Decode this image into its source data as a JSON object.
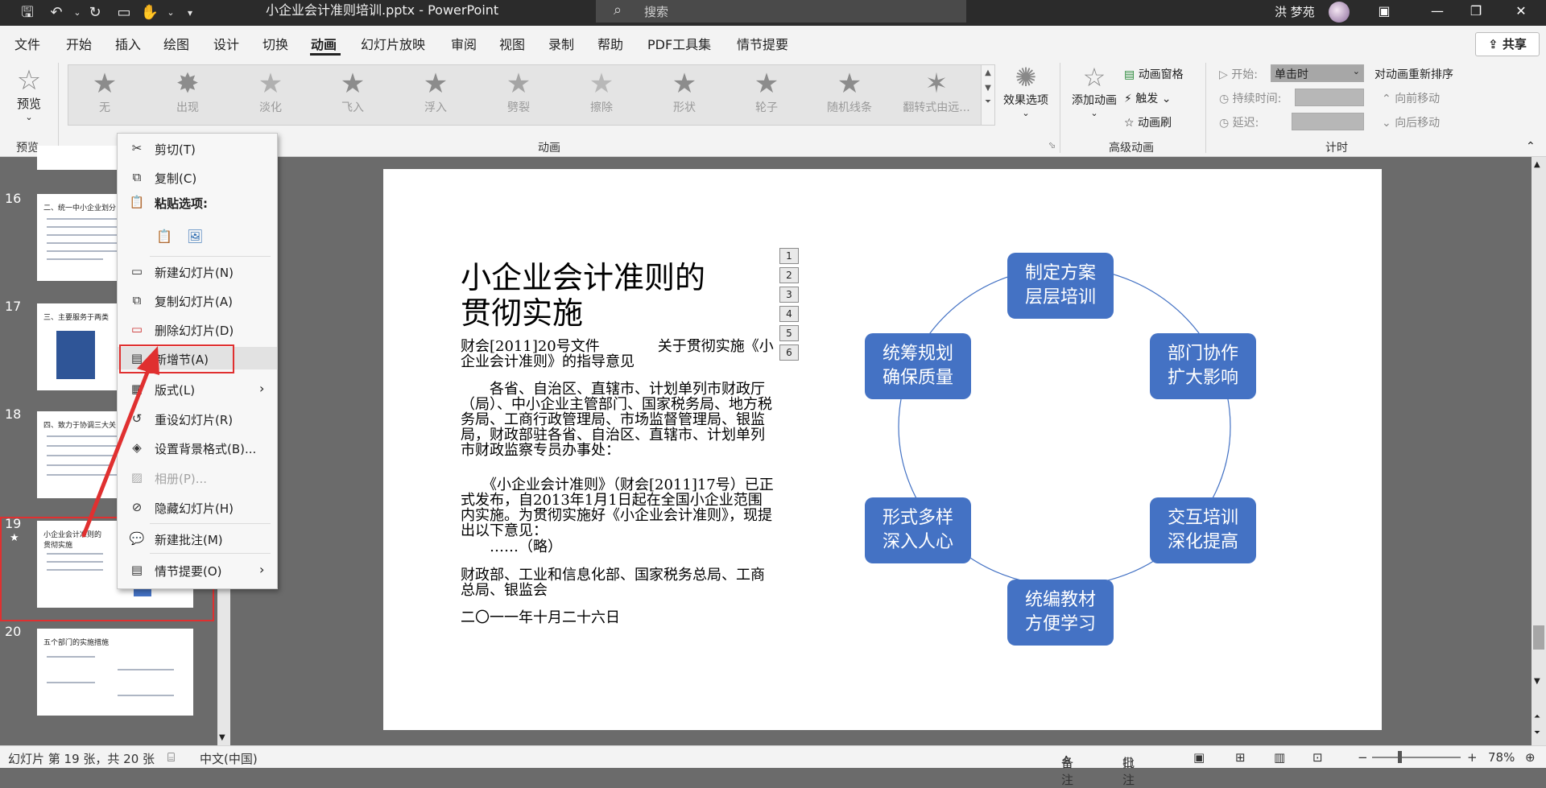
{
  "titlebar": {
    "doc_title": "小企业会计准则培训.pptx  -  PowerPoint",
    "search_placeholder": "搜索",
    "user_name": "洪 梦苑"
  },
  "menu": {
    "tabs": [
      "文件",
      "开始",
      "插入",
      "绘图",
      "设计",
      "切换",
      "动画",
      "幻灯片放映",
      "审阅",
      "视图",
      "录制",
      "帮助",
      "PDF工具集",
      "情节提要"
    ],
    "active_tab": "动画",
    "share_label": "共享"
  },
  "ribbon": {
    "preview_label": "预览",
    "preview_group": "预览",
    "animations": [
      "无",
      "出现",
      "淡化",
      "飞入",
      "浮入",
      "劈裂",
      "擦除",
      "形状",
      "轮子",
      "随机线条",
      "翻转式由远..."
    ],
    "effect_options": "效果选项",
    "animation_group": "动画",
    "add_animation": "添加动画",
    "animation_pane": "动画窗格",
    "trigger": "触发",
    "animation_painter": "动画刷",
    "advanced_group": "高级动画",
    "start_label": "开始:",
    "start_value": "单击时",
    "duration_label": "持续时间:",
    "delay_label": "延迟:",
    "timing_group": "计时",
    "reorder_label": "对动画重新排序",
    "move_earlier": "向前移动",
    "move_later": "向后移动"
  },
  "thumbnails": [
    {
      "num": "16",
      "title": "二、统一中小企业划分"
    },
    {
      "num": "17",
      "title": "三、主要服务于两类"
    },
    {
      "num": "18",
      "title": "四、致力于协调三大关"
    },
    {
      "num": "19",
      "title": "小企业会计准则的贯彻实施"
    },
    {
      "num": "20",
      "title": "五个部门的实施措施"
    }
  ],
  "context_menu": {
    "cut": "剪切(T)",
    "copy": "复制(C)",
    "paste_options": "粘贴选项:",
    "new_slide": "新建幻灯片(N)",
    "duplicate_slide": "复制幻灯片(A)",
    "delete_slide": "删除幻灯片(D)",
    "add_section": "新增节(A)",
    "layout": "版式(L)",
    "reset_slide": "重设幻灯片(R)",
    "format_background": "设置背景格式(B)...",
    "photo_album": "相册(P)...",
    "hide_slide": "隐藏幻灯片(H)",
    "new_comment": "新建批注(M)",
    "storyboard": "情节提要(O)"
  },
  "slide": {
    "title": "小企业会计准则的贯彻实施",
    "para1": "财会[2011]20号文件　　　　关于贯彻实施《小企业会计准则》的指导意见",
    "para2": "　　各省、自治区、直辖市、计划单列市财政厅（局）、中小企业主管部门、国家税务局、地方税务局、工商行政管理局、市场监督管理局、银监局，财政部驻各省、自治区、直辖市、计划单列市财政监察专员办事处：",
    "para3": "　　《小企业会计准则》（财会[2011]17号）已正式发布，自2013年1月1日起在全国小企业范围内实施。为贯彻实施好《小企业会计准则》，现提出以下意见：",
    "para4": "　　……（略）",
    "para5": "财政部、工业和信息化部、国家税务总局、工商总局、银监会",
    "para6": "二〇一一年十月二十六日",
    "anim_markers": [
      "1",
      "2",
      "3",
      "4",
      "5",
      "6"
    ],
    "cycle_nodes": [
      "制定方案\n层层培训",
      "部门协作\n扩大影响",
      "交互培训\n深化提高",
      "统编教材\n方便学习",
      "形式多样\n深入人心",
      "统筹规划\n确保质量"
    ],
    "node_color": "#4472c4"
  },
  "status": {
    "slide_info": "幻灯片 第 19 张，共 20 张",
    "language": "中文(中国)",
    "notes": "备注",
    "comments": "批注",
    "zoom": "78%"
  },
  "colors": {
    "accent_red": "#e03030",
    "titlebar": "#2b2b2b"
  }
}
